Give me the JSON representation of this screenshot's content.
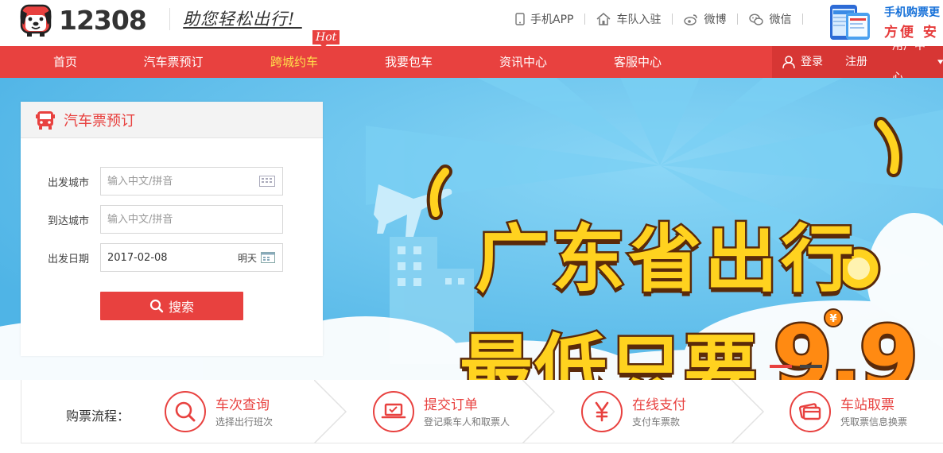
{
  "brand": {
    "logo_text": "12308",
    "slogan": "助您轻松出行!"
  },
  "top_links": [
    {
      "label": "手机APP",
      "icon": "phone-icon"
    },
    {
      "label": "车队入驻",
      "icon": "home-icon"
    },
    {
      "label": "微博",
      "icon": "weibo-icon"
    },
    {
      "label": "微信",
      "icon": "wechat-icon"
    }
  ],
  "promo": {
    "line1": "手机购票更",
    "line2": "方便 安"
  },
  "nav": {
    "items": [
      "首页",
      "汽车票预订",
      "跨城约车",
      "我要包车",
      "资讯中心",
      "客服中心"
    ],
    "active_index": 2,
    "hot_badge": "Hot",
    "login": "登录",
    "register": "注册",
    "user_center": "用户中心"
  },
  "booking": {
    "title": "汽车票预订",
    "from_label": "出发城市",
    "from_placeholder": "输入中文/拼音",
    "to_label": "到达城市",
    "to_placeholder": "输入中文/拼音",
    "date_label": "出发日期",
    "date_value": "2017-02-08",
    "date_hint": "明天",
    "search_label": "搜索"
  },
  "banner": {
    "line1": "广东省出行",
    "line2": "最低只要",
    "price": "9.9",
    "slide_count": 2,
    "active_slide": 0
  },
  "process": {
    "label": "购票流程：",
    "steps": [
      {
        "title": "车次查询",
        "sub": "选择出行班次",
        "icon": "search-icon"
      },
      {
        "title": "提交订单",
        "sub": "登记乘车人和取票人",
        "icon": "laptop-icon"
      },
      {
        "title": "在线支付",
        "sub": "支付车票款",
        "icon": "yen-icon"
      },
      {
        "title": "车站取票",
        "sub": "凭取票信息换票",
        "icon": "card-icon"
      }
    ]
  },
  "colors": {
    "brand_red": "#e8413f",
    "nav_active": "#ffe04b",
    "banner_blue": "#6cc7f0",
    "headline_yellow": "#ffd21f",
    "price_orange": "#ff8a12"
  }
}
